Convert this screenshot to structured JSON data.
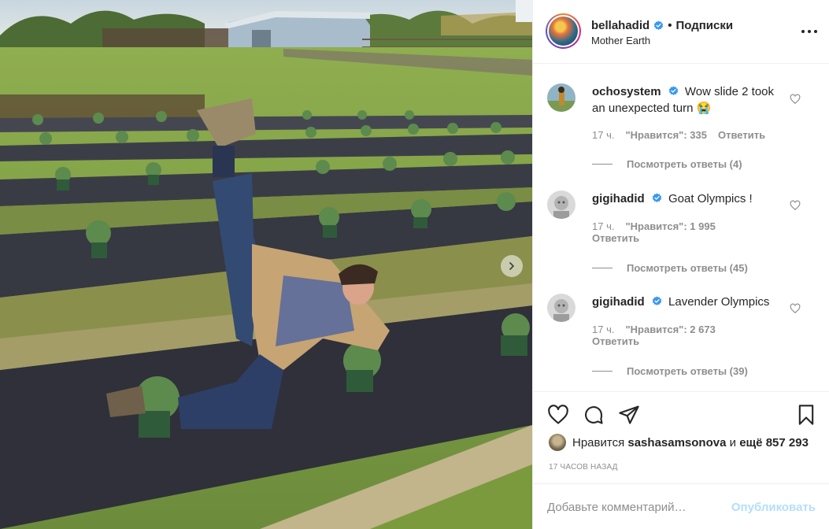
{
  "post": {
    "carousel_next_icon": "chevron-right-icon"
  },
  "header": {
    "username": "bellahadid",
    "separator": "•",
    "follow_label": "Подписки",
    "location": "Mother Earth",
    "more_icon": "more-horizontal-icon"
  },
  "comments": [
    {
      "username": "ochosystem",
      "text": "Wow slide 2 took an unexpected turn 😭",
      "time": "17 ч.",
      "likes": "\"Нравится\": 335",
      "reply_label": "Ответить",
      "view_replies": "Посмотреть ответы (4)"
    },
    {
      "username": "gigihadid",
      "text": "Goat Olympics !",
      "time": "17 ч.",
      "likes": "\"Нравится\": 1 995",
      "reply_label": "Ответить",
      "view_replies": "Посмотреть ответы (45)"
    },
    {
      "username": "gigihadid",
      "text": "Lavender Olympics",
      "time": "17 ч.",
      "likes": "\"Нравится\": 2 673",
      "reply_label": "Ответить",
      "view_replies": "Посмотреть ответы (39)"
    }
  ],
  "likes": {
    "prefix": "Нравится",
    "user": "sashasamsonova",
    "and": "и",
    "more": "ещё 857 293"
  },
  "timestamp": "17 ЧАСОВ НАЗАД",
  "add_comment": {
    "placeholder": "Добавьте комментарий…",
    "post_label": "Опубликовать"
  },
  "colors": {
    "verified": "#3897f0",
    "post_button_disabled": "#b2dffc",
    "secondary_text": "#8e8e8e"
  }
}
